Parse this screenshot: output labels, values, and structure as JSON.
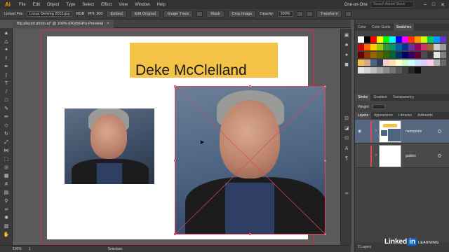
{
  "app": {
    "logo": "Ai"
  },
  "menu": [
    "File",
    "Edit",
    "Object",
    "Type",
    "Select",
    "Effect",
    "View",
    "Window",
    "Help"
  ],
  "workspace": "One-on-One",
  "search": {
    "placeholder": "Search Adobe Stock"
  },
  "control_bar": {
    "linked_file_label": "Linked File",
    "file_name": "Locus Deming 2015.jpg",
    "rgb_label": "RGB",
    "ppi_label": "PPI: 300",
    "embed": "Embed",
    "edit_original": "Edit Original",
    "image_trace": "Image Trace",
    "mask": "Mask",
    "crop_image": "Crop Image",
    "opacity_label": "Opacity:",
    "opacity_value": "100%",
    "transform": "Transform"
  },
  "document_tab": {
    "title": "Big placed photo.ai* @ 100% (RGB/GPU Preview)",
    "close": "×"
  },
  "artboard": {
    "name_text": "Deke McClelland",
    "name_box_color": "#f4c247"
  },
  "status_bar": {
    "zoom": "100%",
    "page": "1",
    "mode": "Selection"
  },
  "panels": {
    "color_tabs": [
      "Color",
      "Color Guide",
      "Swatches"
    ],
    "active_color_tab": "Swatches",
    "stroke_tabs": [
      "Stroke",
      "Gradient",
      "Transparency"
    ],
    "weight_label": "Weight:",
    "layers_tabs": [
      "Layers",
      "Appearance",
      "Libraries",
      "Artboards"
    ],
    "layers": [
      {
        "name": "nameplate",
        "color": "#e0475f",
        "selected": true
      },
      {
        "name": "guides",
        "color": "#e0475f",
        "selected": false
      }
    ],
    "layer_count": "2 Layers"
  },
  "watermark": {
    "brand": "Linked",
    "in": "in",
    "sub": "LEARNING"
  },
  "colors": {
    "selection": "#e0475f",
    "accent": "#ff9a00"
  }
}
